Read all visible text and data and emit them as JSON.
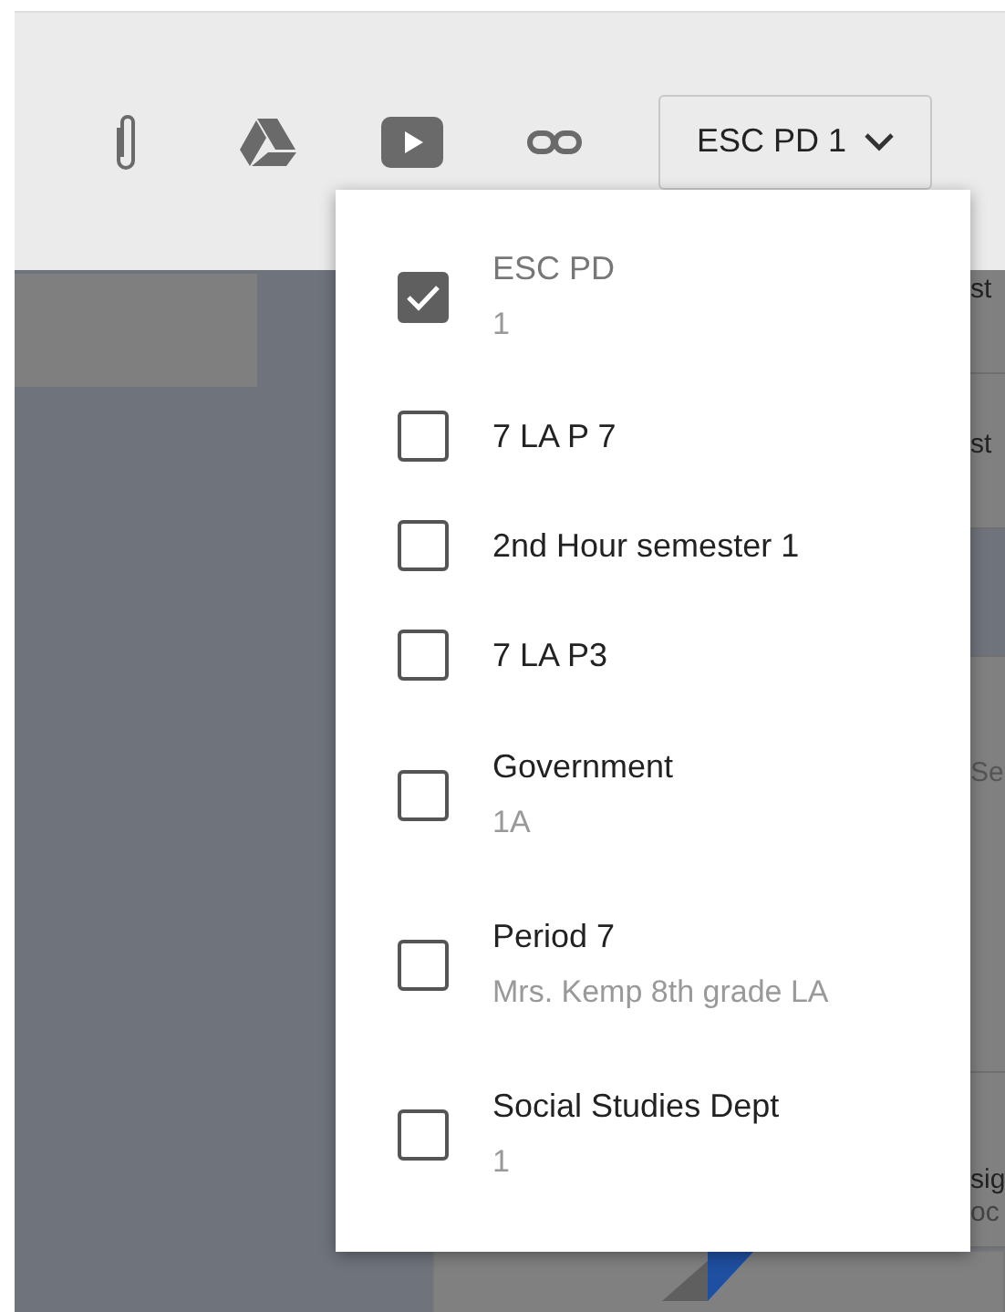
{
  "class_selector": {
    "label": "ESC PD 1",
    "expanded": true
  },
  "class_menu": {
    "items": [
      {
        "name": "ESC PD",
        "section": "1",
        "checked": true
      },
      {
        "name": "7 LA P 7",
        "checked": false
      },
      {
        "name": "2nd Hour semester 1",
        "checked": false
      },
      {
        "name": "7 LA P3",
        "checked": false
      },
      {
        "name": "Government",
        "section": "1A",
        "checked": false
      },
      {
        "name": "Period 7",
        "section": "Mrs. Kemp 8th grade LA",
        "checked": false
      },
      {
        "name": "Social Studies Dept",
        "section": "1",
        "checked": false
      }
    ]
  },
  "background_fragments": [
    "st",
    "st",
    "Se",
    "sig",
    "oc"
  ]
}
